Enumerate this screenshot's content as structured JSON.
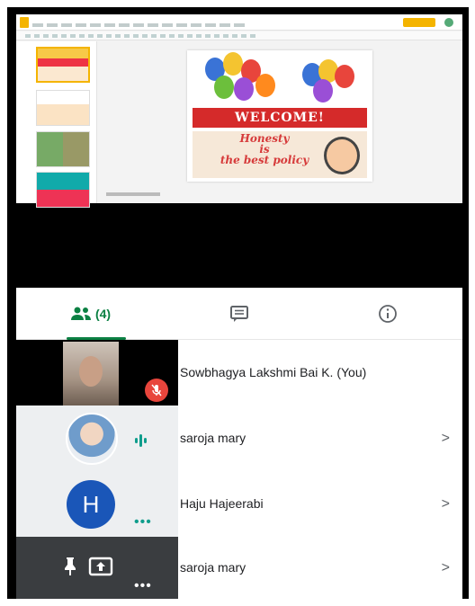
{
  "editor": {
    "slide": {
      "banner_text": "WELCOME!",
      "motto_line1": "Honesty",
      "motto_line2": "is",
      "motto_line3": "the best policy"
    }
  },
  "tabs": {
    "people_count": "(4)",
    "people_icon": "people-icon",
    "chat_icon": "chat-icon",
    "info_icon": "info-icon",
    "accent_color": "#0b8043"
  },
  "participants": [
    {
      "name": "Sowbhagya Lakshmi Bai K. (You)",
      "status": "mic-muted",
      "avatar": "camera-video"
    },
    {
      "name": "saroja mary",
      "status": "speaking",
      "avatar": "photo",
      "chevron": ">"
    },
    {
      "name": "Haju Hajeerabi",
      "status": "more",
      "avatar_letter": "H",
      "chevron": ">"
    },
    {
      "name": "saroja mary",
      "status": "presenting",
      "avatar": "presentation",
      "chevron": ">"
    }
  ]
}
